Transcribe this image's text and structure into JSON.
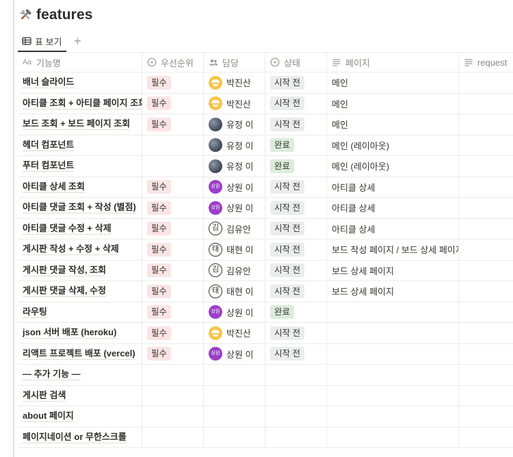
{
  "page": {
    "title": "features",
    "icon": "hammer-and-wrench-icon"
  },
  "view_tabs": [
    {
      "label": "표 보기",
      "icon": "table-icon"
    }
  ],
  "columns": [
    {
      "label": "기능명",
      "icon": "text-aa-icon"
    },
    {
      "label": "우선순위",
      "icon": "select-icon"
    },
    {
      "label": "담당",
      "icon": "person-icon"
    },
    {
      "label": "상태",
      "icon": "select-icon"
    },
    {
      "label": "페이지",
      "icon": "lines-icon"
    },
    {
      "label": "request",
      "icon": "lines-icon"
    }
  ],
  "rows": [
    {
      "name": "배너 슬라이드",
      "priority": "필수",
      "owner": "박진산",
      "avatar": "yellow",
      "status": "시작 전",
      "page": "메인"
    },
    {
      "name": "아티클 조회 + 아티클 페이지 조회",
      "priority": "필수",
      "owner": "박진산",
      "avatar": "yellow",
      "status": "시작 전",
      "page": "메인"
    },
    {
      "name": "보드 조회 + 보드 페이지 조회",
      "priority": "필수",
      "owner": "유정 이",
      "avatar": "blue",
      "status": "시작 전",
      "page": "메인"
    },
    {
      "name": "헤더 컴포넌트",
      "priority": "",
      "owner": "유정 이",
      "avatar": "blue",
      "status": "완료",
      "page": "메인 (레이아웃)"
    },
    {
      "name": "푸터 컴포넌트",
      "priority": "",
      "owner": "유정 이",
      "avatar": "blue",
      "status": "완료",
      "page": "메인 (레이아웃)"
    },
    {
      "name": "아티클 상세 조회",
      "priority": "필수",
      "owner": "상원 이",
      "avatar": "purple",
      "avatar_text": "상원",
      "status": "시작 전",
      "page": "아티클 상세"
    },
    {
      "name": "아티클 댓글 조회 + 작성 (별점)",
      "priority": "필수",
      "owner": "상원 이",
      "avatar": "purple",
      "avatar_text": "상원",
      "status": "시작 전",
      "page": "아티클 상세"
    },
    {
      "name": "아티클 댓글 수정 + 삭제",
      "priority": "필수",
      "owner": "김유안",
      "avatar": "letter",
      "avatar_text": "김",
      "status": "시작 전",
      "page": "아티클 상세"
    },
    {
      "name": "게시판 작성 + 수정 + 삭제",
      "priority": "필수",
      "owner": "태현 이",
      "avatar": "letter",
      "avatar_text": "태",
      "status": "시작 전",
      "page": "보드 작성 페이지 / 보드 상세 페이지"
    },
    {
      "name": "게시판 댓글 작성, 조회",
      "priority": "필수",
      "owner": "김유안",
      "avatar": "letter",
      "avatar_text": "김",
      "status": "시작 전",
      "page": "보드 상세 페이지"
    },
    {
      "name": "게시판 댓글 삭제, 수정",
      "priority": "필수",
      "owner": "태현 이",
      "avatar": "letter",
      "avatar_text": "태",
      "status": "시작 전",
      "page": "보드 상세 페이지"
    },
    {
      "name": "라우팅",
      "priority": "필수",
      "owner": "상원 이",
      "avatar": "purple",
      "avatar_text": "상원",
      "status": "완료",
      "page": ""
    },
    {
      "name": "json 서버 배포 (heroku)",
      "priority": "필수",
      "owner": "박진산",
      "avatar": "yellow",
      "status": "시작 전",
      "page": ""
    },
    {
      "name": "리액트 프로젝트 배포 (vercel)",
      "priority": "필수",
      "owner": "상원 이",
      "avatar": "purple",
      "avatar_text": "상원",
      "status": "시작 전",
      "page": ""
    },
    {
      "name": "— 추가 기능 —",
      "priority": "",
      "owner": "",
      "avatar": "",
      "status": "",
      "page": ""
    },
    {
      "name": "게시판 검색",
      "priority": "",
      "owner": "",
      "avatar": "",
      "status": "",
      "page": ""
    },
    {
      "name": "about 페이지",
      "priority": "",
      "owner": "",
      "avatar": "",
      "status": "",
      "page": ""
    },
    {
      "name": "페이지네이션 or 무한스크롤",
      "priority": "",
      "owner": "",
      "avatar": "",
      "status": "",
      "page": ""
    }
  ],
  "colors": {
    "required_tag": "#fbe4e4",
    "todo_tag": "#ebeced",
    "done_tag": "#dbeddb"
  }
}
